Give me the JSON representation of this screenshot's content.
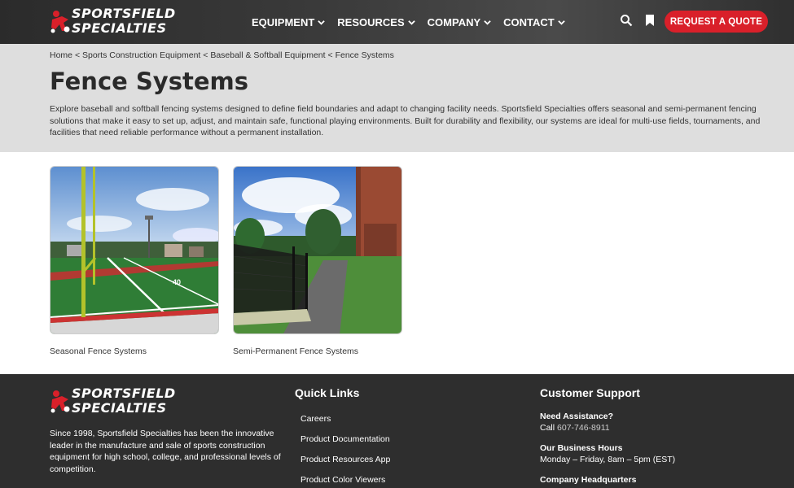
{
  "header": {
    "logo_line1": "SPORTSFIELD",
    "logo_line2": "SPECIALTIES",
    "nav": [
      "EQUIPMENT",
      "RESOURCES",
      "COMPANY",
      "CONTACT"
    ],
    "quote_button": "REQUEST A QUOTE",
    "icons": [
      "search-icon",
      "bookmark-icon",
      "chevron-down-icon"
    ]
  },
  "breadcrumb": {
    "home": "Home",
    "sep": "<",
    "level1": "Sports Construction Equipment",
    "level2": "Baseball & Softball Equipment",
    "current": "Fence Systems"
  },
  "page": {
    "title": "Fence Systems",
    "intro": "Explore baseball and softball fencing systems designed to define field boundaries and adapt to changing facility needs. Sportsfield Specialties offers seasonal and semi-permanent fencing solutions that make it easy to set up, adjust, and maintain safe, functional playing environments. Built for durability and flexibility, our systems are ideal for multi-use fields, tournaments, and facilities that need reliable performance without a permanent installation."
  },
  "cards": [
    {
      "caption": "Seasonal Fence Systems"
    },
    {
      "caption": "Semi-Permanent Fence Systems"
    }
  ],
  "footer": {
    "about": "Since 1998, Sportsfield Specialties has been the innovative leader in the manufacture and sale of sports construction equipment for high school, college, and professional levels of competition.",
    "quick_links_title": "Quick Links",
    "quick_links": [
      "Careers",
      "Product Documentation",
      "Product Resources App",
      "Product Color Viewers"
    ],
    "support_title": "Customer Support",
    "need_assistance": "Need Assistance?",
    "call_prefix": "Call",
    "phone": "607-746-8911",
    "hours_title": "Our Business Hours",
    "hours": "Monday – Friday, 8am – 5pm (EST)",
    "hq_title": "Company Headquarters"
  },
  "colors": {
    "accent": "#d9202a",
    "header_bg": "#3a3a3a",
    "hero_bg": "#dedede",
    "footer_bg": "#2e2e2e"
  }
}
